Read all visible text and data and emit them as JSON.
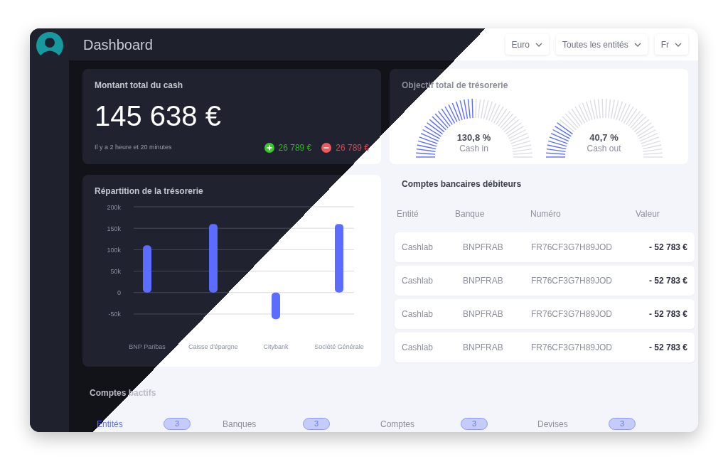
{
  "header": {
    "title": "Dashboard",
    "dropdowns": [
      {
        "label": "Euro"
      },
      {
        "label": "Toutes les entités"
      },
      {
        "label": "Fr"
      }
    ]
  },
  "cash_card": {
    "title": "Montant total du cash",
    "amount": "145 638 €",
    "updated": "Il y a 2 heure et 20 minutes",
    "inflow": "26 789 €",
    "outflow": "26 789 €"
  },
  "objective_card": {
    "title": "Objectif total de trésorerie",
    "gauges": [
      {
        "value": "130,8 %",
        "label": "Cash in",
        "level": 0.5
      },
      {
        "value": "40,7 %",
        "label": "Cash out",
        "level": 0.22
      }
    ]
  },
  "distribution_card": {
    "title": "Répartition de la trésorerie",
    "chart_data": {
      "type": "bar",
      "categories": [
        "BNP Paribas",
        "Caisse d'épargne",
        "Citybank",
        "Société Générale"
      ],
      "series": [
        {
          "color": "#5b6cff",
          "values": [
            110000,
            160000,
            -62000,
            160000
          ]
        }
      ],
      "grid": true,
      "ylim": [
        -65000,
        200000
      ],
      "yticks": [
        {
          "value": 200000,
          "label": "200k"
        },
        {
          "value": 150000,
          "label": "150k"
        },
        {
          "value": 100000,
          "label": "100k"
        },
        {
          "value": 50000,
          "label": "50k"
        },
        {
          "value": 0,
          "label": "0"
        },
        {
          "value": -50000,
          "label": "-50k"
        }
      ]
    }
  },
  "debit_accounts": {
    "title": "Comptes bancaires débiteurs",
    "columns": [
      "Entité",
      "Banque",
      "Numéro",
      "Valeur"
    ],
    "rows": [
      [
        "Cashlab",
        "BNPFRAB",
        "FR76CF3G7H89JOD",
        "- 52 783 €"
      ],
      [
        "Cashlab",
        "BNPFRAB",
        "FR76CF3G7H89JOD",
        "- 52 783 €"
      ],
      [
        "Cashlab",
        "BNPFRAB",
        "FR76CF3G7H89JOD",
        "- 52 783 €"
      ],
      [
        "Cashlab",
        "BNPFRAB",
        "FR76CF3G7H89JOD",
        "- 52 783 €"
      ]
    ]
  },
  "active_accounts": {
    "title": "Comptes bactifs",
    "tabs": [
      {
        "label": "Entités",
        "count": "3",
        "selected": true
      },
      {
        "label": "Banques",
        "count": "3",
        "selected": false
      },
      {
        "label": "Comptes",
        "count": "3",
        "selected": false
      },
      {
        "label": "Devises",
        "count": "3",
        "selected": false
      }
    ]
  }
}
